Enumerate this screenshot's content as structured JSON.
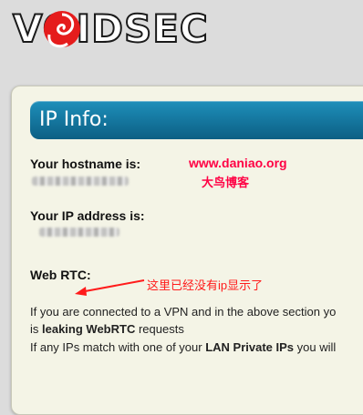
{
  "logo": {
    "text": "VOIDSEC"
  },
  "card": {
    "title": "IP Info:"
  },
  "hostname": {
    "label": "Your hostname is:"
  },
  "ip": {
    "label": "Your IP address is:"
  },
  "webrtc": {
    "label": "Web RTC:"
  },
  "watermark": {
    "url": "www.daniao.org",
    "name": "大鸟博客"
  },
  "annotation": {
    "text": "这里已经没有ip显示了"
  },
  "lines": {
    "line1": "If you are connected to a VPN and in the above section yo",
    "line2_prefix": "is ",
    "line2_bold": "leaking WebRTC",
    "line2_suffix": " requests",
    "line3_prefix": "If any IPs match with one of your ",
    "line3_bold": "LAN Private IPs",
    "line3_suffix": " you will"
  },
  "colors": {
    "title_bar": "#137aa3",
    "watermark": "#ff0044",
    "annotation": "#ff1b1b"
  }
}
